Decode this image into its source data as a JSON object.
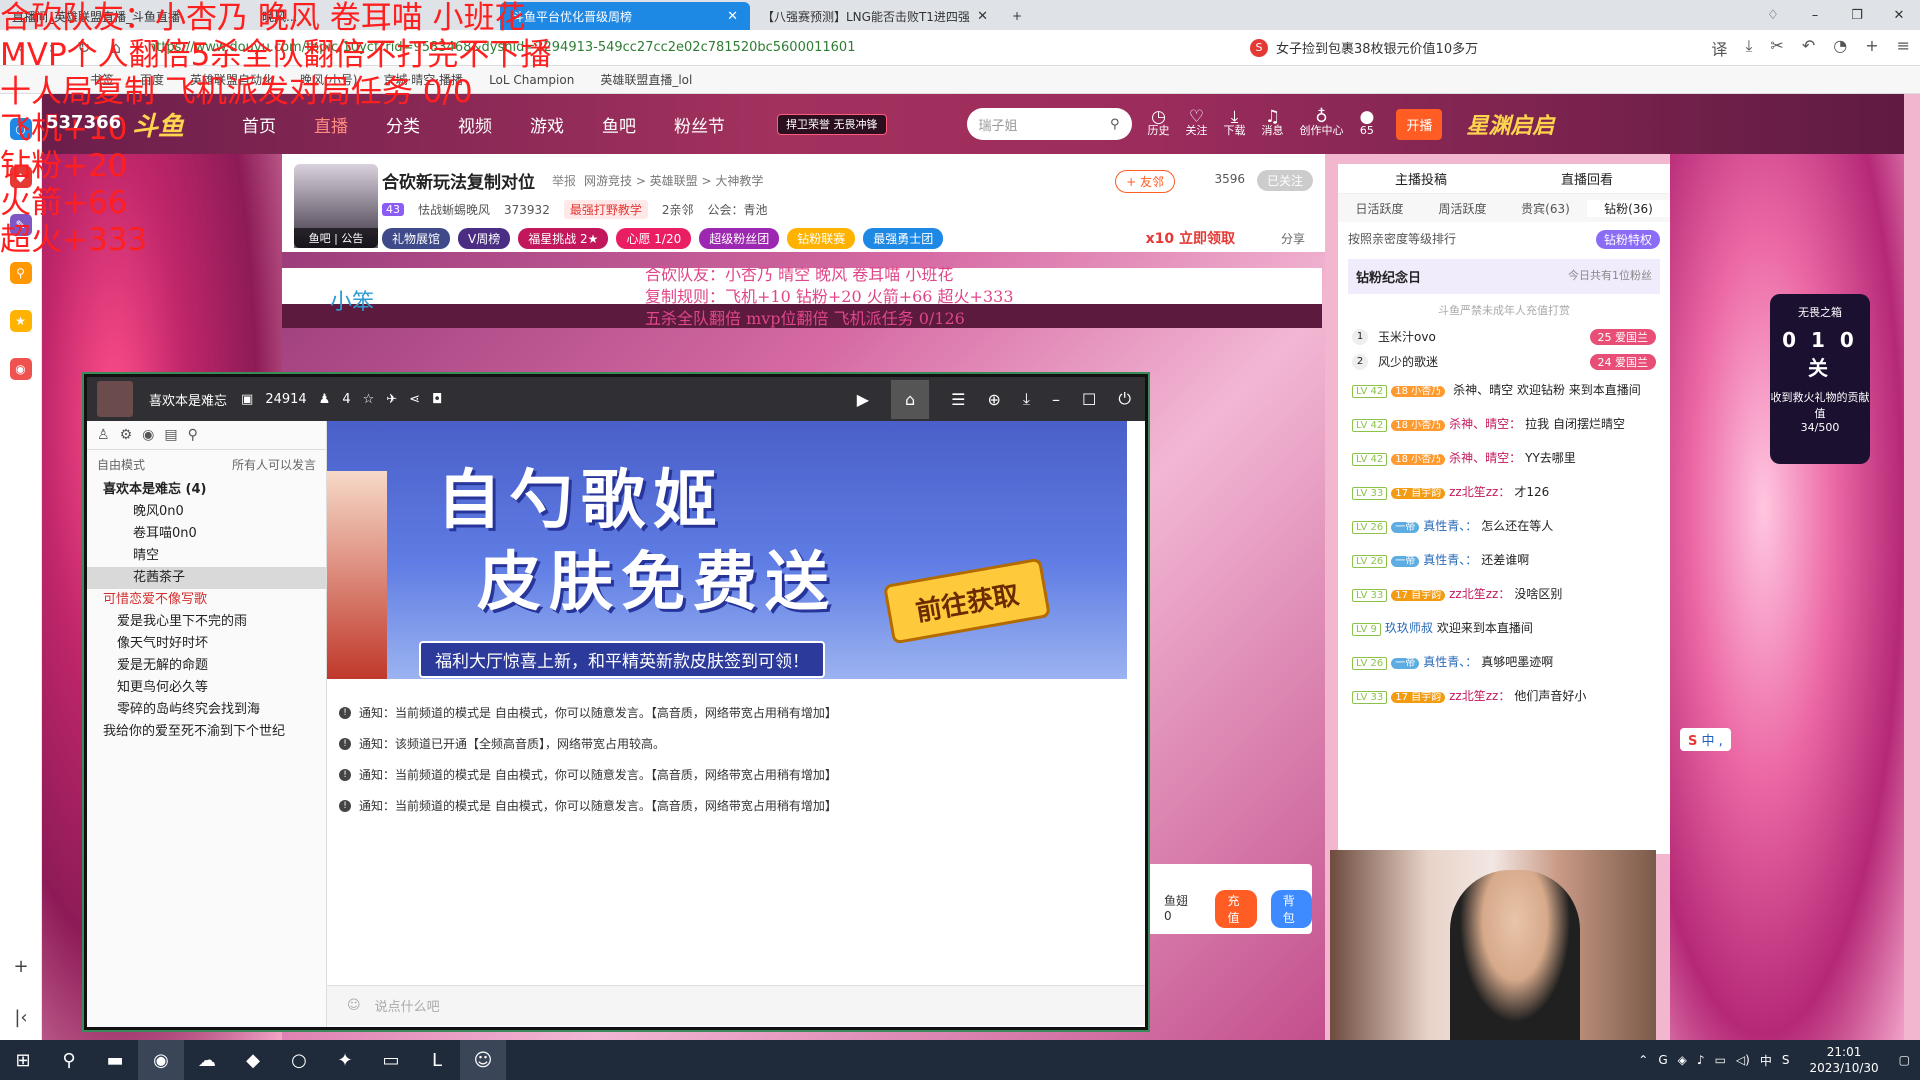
{
  "browser": {
    "tabs": [
      {
        "label": "直播间_英雄联盟直播_斗鱼直播"
      },
      {
        "label": "晚风..."
      },
      {
        "label": "斗鱼平台优化晋级周榜"
      },
      {
        "label": "【八强赛预测】LNG能否击败T1进四强"
      }
    ],
    "new_tab": "+",
    "url_domain": "www.douyu.com",
    "url": "https://www.douyu.com/topic/10ycf?rid=9583468&dyshid=2294913-549cc27cc2e02c781520bc5600011601",
    "news": "女子捡到包裹38枚银元价值10多万",
    "news_icon": "S",
    "bookmarks": [
      "书签",
      "百度",
      "英雄联盟自动化",
      "晚风(小号)",
      "京城·晴空·播播",
      "LoL Champion",
      "英雄联盟直播_lol"
    ]
  },
  "overlay": {
    "line1": "合砍队友：小杏乃  晚风  卷耳喵  小班花",
    "line2": "MVP个人翻倍5杀全队翻倍不打完不下播",
    "line3": "十人局复制 飞机派发对局任务  0/0",
    "line4": "飞机+10",
    "line5": "钻粉+20",
    "line6": "火箭+66",
    "line7": "超火+333",
    "viewer_count": "537366"
  },
  "stream_overlay": {
    "line1": "合砍队友：小杏乃  晴空  晚风  卷耳喵  小班花",
    "line2": "复制规则：飞机+10  钻粉+20  火箭+66  超火+333",
    "line3": "五杀全队翻倍  mvp位翻倍  飞机派任务   0/126",
    "mouse_hint": "小笨"
  },
  "site": {
    "logo": "斗鱼",
    "nav": [
      "首页",
      "直播",
      "分类",
      "视频",
      "游戏",
      "鱼吧",
      "粉丝节"
    ],
    "promo_badge": "捍卫荣誉 无畏冲锋",
    "search_placeholder": "瑞子姐",
    "header_icons": [
      "历史",
      "关注",
      "下载",
      "消息",
      "创作中心"
    ],
    "message_count": "1",
    "avatar_badge": "65",
    "open_button": "开播",
    "event_logo": "星渊启启"
  },
  "room": {
    "avatar_caption": "鱼吧 | 公告",
    "title": "合砍新玩法复制对位",
    "report": "举报",
    "categories": "网游竞技 > 英雄联盟 > 大神教学",
    "level": "43",
    "streamer": "怯战蜥蜴晚风",
    "hot": "373932",
    "tag": "最强打野教学",
    "fans_text": "2亲邻",
    "guild": "公会：青池",
    "pills": [
      "礼物展馆",
      "V周榜",
      "福星挑战 2★",
      "心愿 1/20",
      "超级粉丝团",
      "钻粉联赛",
      "最强勇士团"
    ],
    "follow_btn": "+ 友邻",
    "follow_count": "3596",
    "followed_btn": "已关注",
    "gift_promo": "x10 立即领取",
    "share": "分享"
  },
  "voice_app": {
    "title": "喜欢本是难忘",
    "id": "24914",
    "members": "4",
    "mode": "自由模式",
    "speak_rule": "所有人可以发言",
    "channels": [
      {
        "label": "喜欢本是难忘 (4)",
        "kind": "ch"
      },
      {
        "label": "晚风0n0",
        "kind": "m"
      },
      {
        "label": "卷耳喵0n0",
        "kind": "m"
      },
      {
        "label": "晴空",
        "kind": "m"
      },
      {
        "label": "花茜茶子",
        "kind": "m sel"
      },
      {
        "label": "可惜恋爱不像写歌",
        "kind": "ch red"
      },
      {
        "label": "爱是我心里下不完的雨",
        "kind": "sub"
      },
      {
        "label": "像天气时好时坏",
        "kind": "sub"
      },
      {
        "label": "爱是无解的命题",
        "kind": "sub"
      },
      {
        "label": "知更鸟何必久等",
        "kind": "sub"
      },
      {
        "label": "零碎的岛屿终究会找到海",
        "kind": "sub"
      },
      {
        "label": "我给你的爱至死不渝到下个世纪",
        "kind": "sub plain"
      }
    ],
    "banner": {
      "title1": "自勺歌姬",
      "title2": "皮肤免费送",
      "subtitle": "福利大厅惊喜上新，和平精英新款皮肤签到可领！",
      "cta": "前往获取"
    },
    "messages": [
      "通知：当前频道的模式是 自由模式，你可以随意发言。【高音质，网络带宽占用稍有增加】",
      "通知：该频道已开通【全频高音质】，网络带宽占用较高。",
      "通知：当前频道的模式是 自由模式，你可以随意发言。【高音质，网络带宽占用稍有增加】",
      "通知：当前频道的模式是 自由模式，你可以随意发言。【高音质，网络带宽占用稍有增加】"
    ],
    "input_placeholder": "说点什么吧"
  },
  "chat": {
    "top_tabs": [
      "主播投稿",
      "直播回看"
    ],
    "rank_tabs": [
      "日活跃度",
      "周活跃度",
      "贵宾(63)",
      "钻粉(36)"
    ],
    "rank_note": "按照亲密度等级排行",
    "diamond_priv": "钻粉特权",
    "anniversary": "钻粉纪念日",
    "anniversary_note": "今日共有1位粉丝",
    "protection": "斗鱼严禁未成年人充值打赏",
    "top_fans": [
      {
        "rank": "1",
        "name": "玉米汁ovo",
        "amount": "25 爱国兰"
      },
      {
        "rank": "2",
        "name": "风少的歌迷",
        "amount": "24 爱国兰"
      }
    ],
    "messages": [
      {
        "lv": "LV 42",
        "badge": "18 小杏乃",
        "user": "",
        "text": "杀神、晴空 欢迎钻粉 来到本直播间"
      },
      {
        "lv": "LV 42",
        "badge": "18 小杏乃",
        "user": "杀神、晴空：",
        "text": "拉我 自闭摆烂晴空"
      },
      {
        "lv": "LV 42",
        "badge": "18 小杏乃",
        "user": "杀神、晴空：",
        "text": "YY去哪里"
      },
      {
        "lv": "LV 33",
        "badge": "17 自宇韵",
        "user": "zz北笙zz：",
        "text": "才126"
      },
      {
        "lv": "LV 26",
        "badge": "一帝",
        "user": "真性青、：",
        "text": "怎么还在等人"
      },
      {
        "lv": "LV 26",
        "badge": "一帝",
        "user": "真性青、：",
        "text": "还差谁啊"
      },
      {
        "lv": "LV 33",
        "badge": "17 自宇韵",
        "user": "zz北笙zz：",
        "text": "没啥区别"
      },
      {
        "lv": "LV 9",
        "badge": "",
        "user": "玖玖师叔",
        "text": "欢迎来到本直播间"
      },
      {
        "lv": "LV 26",
        "badge": "一帝",
        "user": "真性青、：",
        "text": "真够吧墨迹啊"
      },
      {
        "lv": "LV 33",
        "badge": "17 自宇韵",
        "user": "zz北笙zz：",
        "text": "他们声音好小"
      }
    ],
    "gift_strip": {
      "fishball": "鱼翅 0",
      "recharge": "充值",
      "backpack": "背包"
    }
  },
  "rightdeco": {
    "title": "无畏之箱",
    "value": "0 1 0 关",
    "desc": "收到救火礼物的贡献值",
    "progress": "34/500"
  },
  "ime": {
    "brand": "S",
    "text": "中 ,"
  },
  "taskbar": {
    "time": "21:01",
    "date": "2023/10/30",
    "tray_lang": "中"
  }
}
